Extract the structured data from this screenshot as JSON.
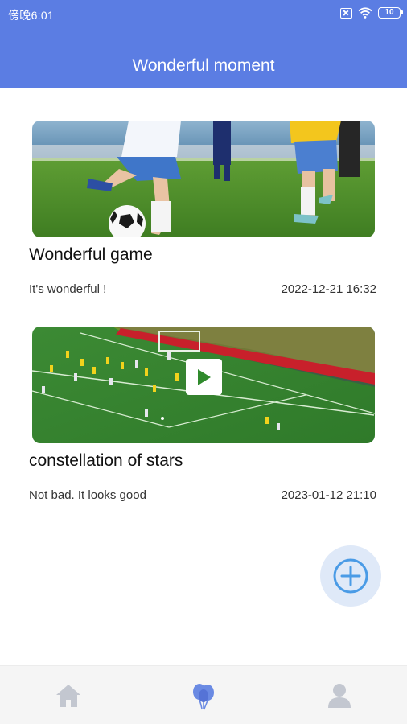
{
  "status_bar": {
    "time": "傍晚6:01",
    "battery": "10",
    "icons": [
      "sim-off-icon",
      "wifi-icon",
      "battery-icon"
    ]
  },
  "header": {
    "title": "Wonderful moment"
  },
  "colors": {
    "header_bg": "#5b7de3",
    "accent": "#4a9be6",
    "tab_active": "#6a8ae3",
    "tab_inactive": "#c3c7d0"
  },
  "posts": [
    {
      "title": "Wonderful game",
      "description": "It's wonderful !",
      "date": "2022-12-21 16:32",
      "media_type": "image"
    },
    {
      "title": "constellation of stars",
      "description": "Not bad. It looks good",
      "date": "2023-01-12 21:10",
      "media_type": "video"
    }
  ],
  "fab": {
    "icon": "plus-circle-icon"
  },
  "tabbar": {
    "items": [
      {
        "icon": "home-icon",
        "active": false
      },
      {
        "icon": "balloons-icon",
        "active": true
      },
      {
        "icon": "user-icon",
        "active": false
      }
    ]
  }
}
